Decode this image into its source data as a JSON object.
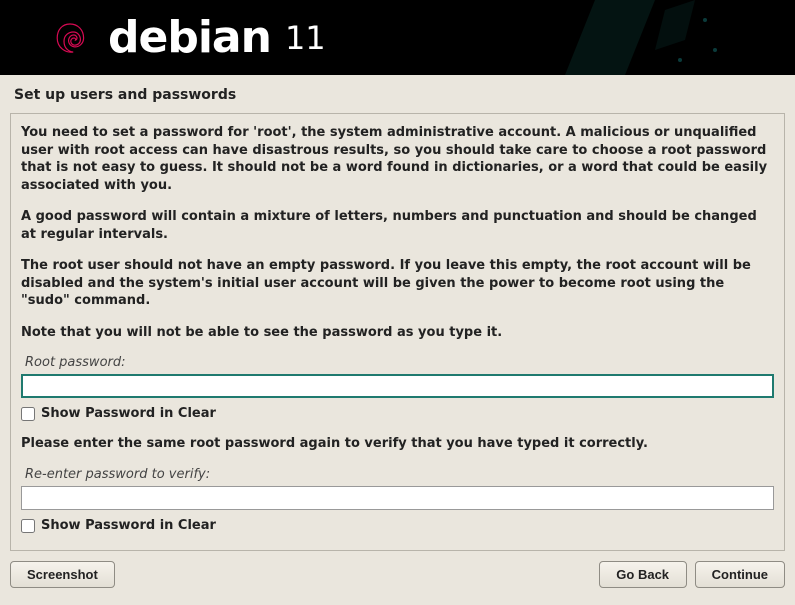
{
  "header": {
    "logo_text": "debian",
    "version": "11"
  },
  "page_title": "Set up users and passwords",
  "paragraphs": {
    "p1": "You need to set a password for 'root', the system administrative account. A malicious or unqualified user with root access can have disastrous results, so you should take care to choose a root password that is not easy to guess. It should not be a word found in dictionaries, or a word that could be easily associated with you.",
    "p2": "A good password will contain a mixture of letters, numbers and punctuation and should be changed at regular intervals.",
    "p3": "The root user should not have an empty password. If you leave this empty, the root account will be disabled and the system's initial user account will be given the power to become root using the \"sudo\" command.",
    "p4": "Note that you will not be able to see the password as you type it.",
    "p5": "Please enter the same root password again to verify that you have typed it correctly."
  },
  "fields": {
    "root_password_label": "Root password:",
    "root_password_value": "",
    "show1_label": "Show Password in Clear",
    "verify_label": "Re-enter password to verify:",
    "verify_value": "",
    "show2_label": "Show Password in Clear"
  },
  "buttons": {
    "screenshot": "Screenshot",
    "go_back": "Go Back",
    "continue": "Continue"
  }
}
